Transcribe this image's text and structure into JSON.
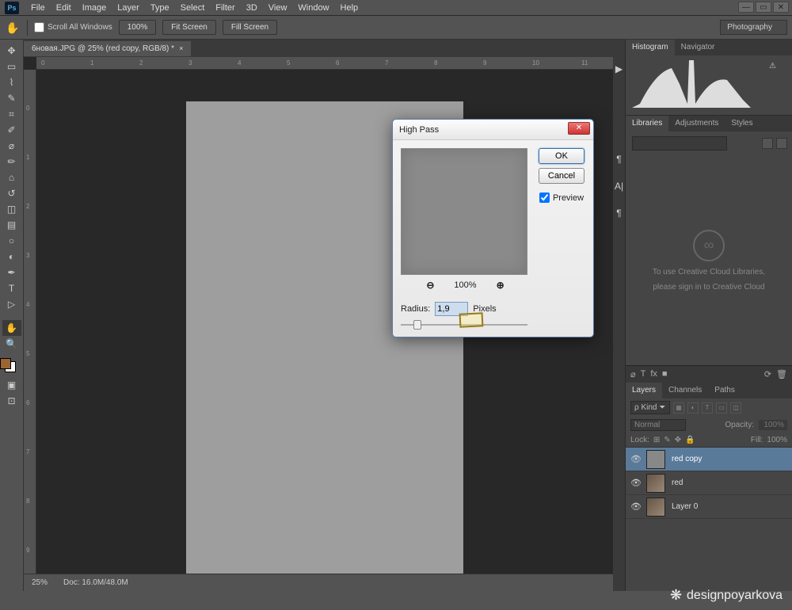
{
  "menu": {
    "items": [
      "File",
      "Edit",
      "Image",
      "Layer",
      "Type",
      "Select",
      "Filter",
      "3D",
      "View",
      "Window",
      "Help"
    ]
  },
  "window": {
    "min": "—",
    "max": "▭",
    "close": "✕"
  },
  "options": {
    "scroll_all": "Scroll All Windows",
    "pct": "100%",
    "fit": "Fit Screen",
    "fill": "Fill Screen"
  },
  "workspace": "Photography",
  "doc_tab": "6новая.JPG @ 25% (red copy, RGB/8) *",
  "ruler_h": [
    "0",
    "1",
    "2",
    "3",
    "4",
    "5",
    "6",
    "7",
    "8",
    "9",
    "10",
    "11"
  ],
  "ruler_v": [
    "0",
    "1",
    "2",
    "3",
    "4",
    "5",
    "6",
    "7",
    "8",
    "9"
  ],
  "status": {
    "zoom": "25%",
    "doc": "Doc: 16.0M/48.0M"
  },
  "panels": {
    "histo_tabs": [
      "Histogram",
      "Navigator"
    ],
    "lib_tabs": [
      "Libraries",
      "Adjustments",
      "Styles"
    ],
    "cc_msg1": "To use Creative Cloud Libraries,",
    "cc_msg2": "please sign in to Creative Cloud",
    "layers_tabs": [
      "Layers",
      "Channels",
      "Paths"
    ],
    "kind": "Kind",
    "blend": "Normal",
    "opacity_lbl": "Opacity:",
    "opacity": "100%",
    "lock_lbl": "Lock:",
    "fill_lbl": "Fill:",
    "fill": "100%",
    "layers": [
      {
        "name": "red copy",
        "sel": true
      },
      {
        "name": "red",
        "sel": false
      },
      {
        "name": "Layer 0",
        "sel": false
      }
    ]
  },
  "dialog": {
    "title": "High Pass",
    "ok": "OK",
    "cancel": "Cancel",
    "preview": "Preview",
    "zoom": "100%",
    "radius_lbl": "Radius:",
    "radius": "1,9",
    "unit": "Pixels"
  },
  "watermark": "designpoyarkova"
}
